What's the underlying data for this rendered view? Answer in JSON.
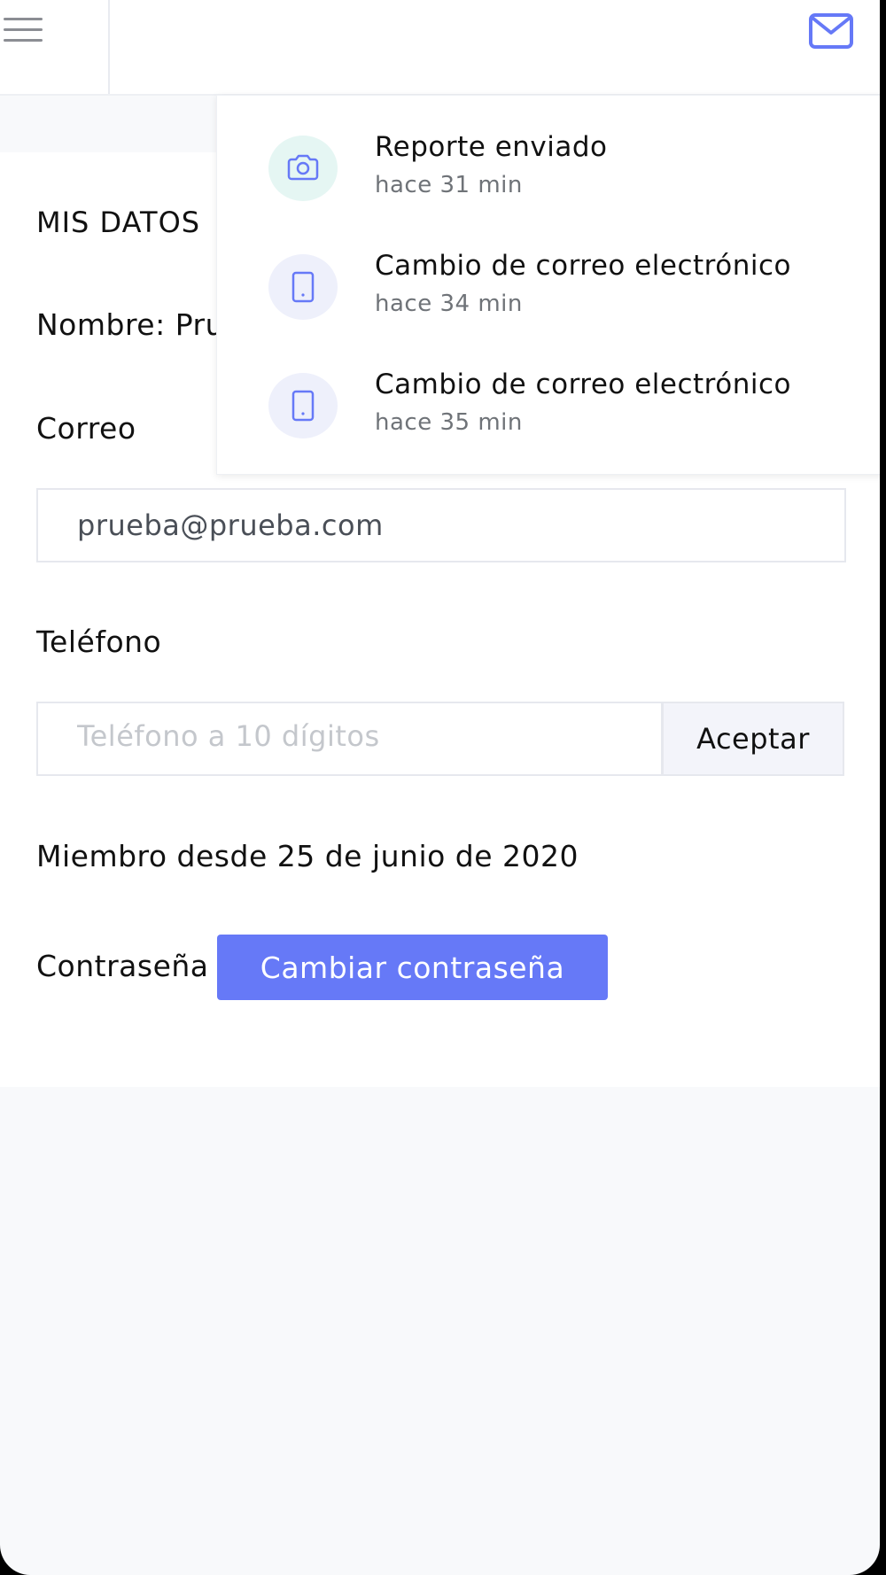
{
  "colors": {
    "accent": "#6679f7",
    "teal_circle": "#e5f6f3",
    "lavender_circle": "#eef0fb",
    "background": "#f8f9fb"
  },
  "header": {
    "menu_icon": "hamburger-menu-icon",
    "mail_icon": "mail-icon"
  },
  "profile": {
    "section_title": "MIS DATOS",
    "nombre_label": "Nombre: Pru",
    "correo_label": "Correo",
    "email_value": "prueba@prueba.com",
    "telefono_label": "Teléfono",
    "telefono_placeholder": "Teléfono a 10 dígitos",
    "aceptar_label": "Aceptar",
    "miembro_text": "Miembro desde 25 de junio de 2020",
    "contrasena_label": "Contraseña",
    "cambiar_label": "Cambiar contraseña"
  },
  "notifications": [
    {
      "icon": "camera-icon",
      "title": "Reporte enviado",
      "time": "hace 31 min"
    },
    {
      "icon": "tablet-icon",
      "title": "Cambio de correo electrónico",
      "time": "hace 34 min"
    },
    {
      "icon": "tablet-icon",
      "title": "Cambio de correo electrónico",
      "time": "hace 35 min"
    }
  ]
}
